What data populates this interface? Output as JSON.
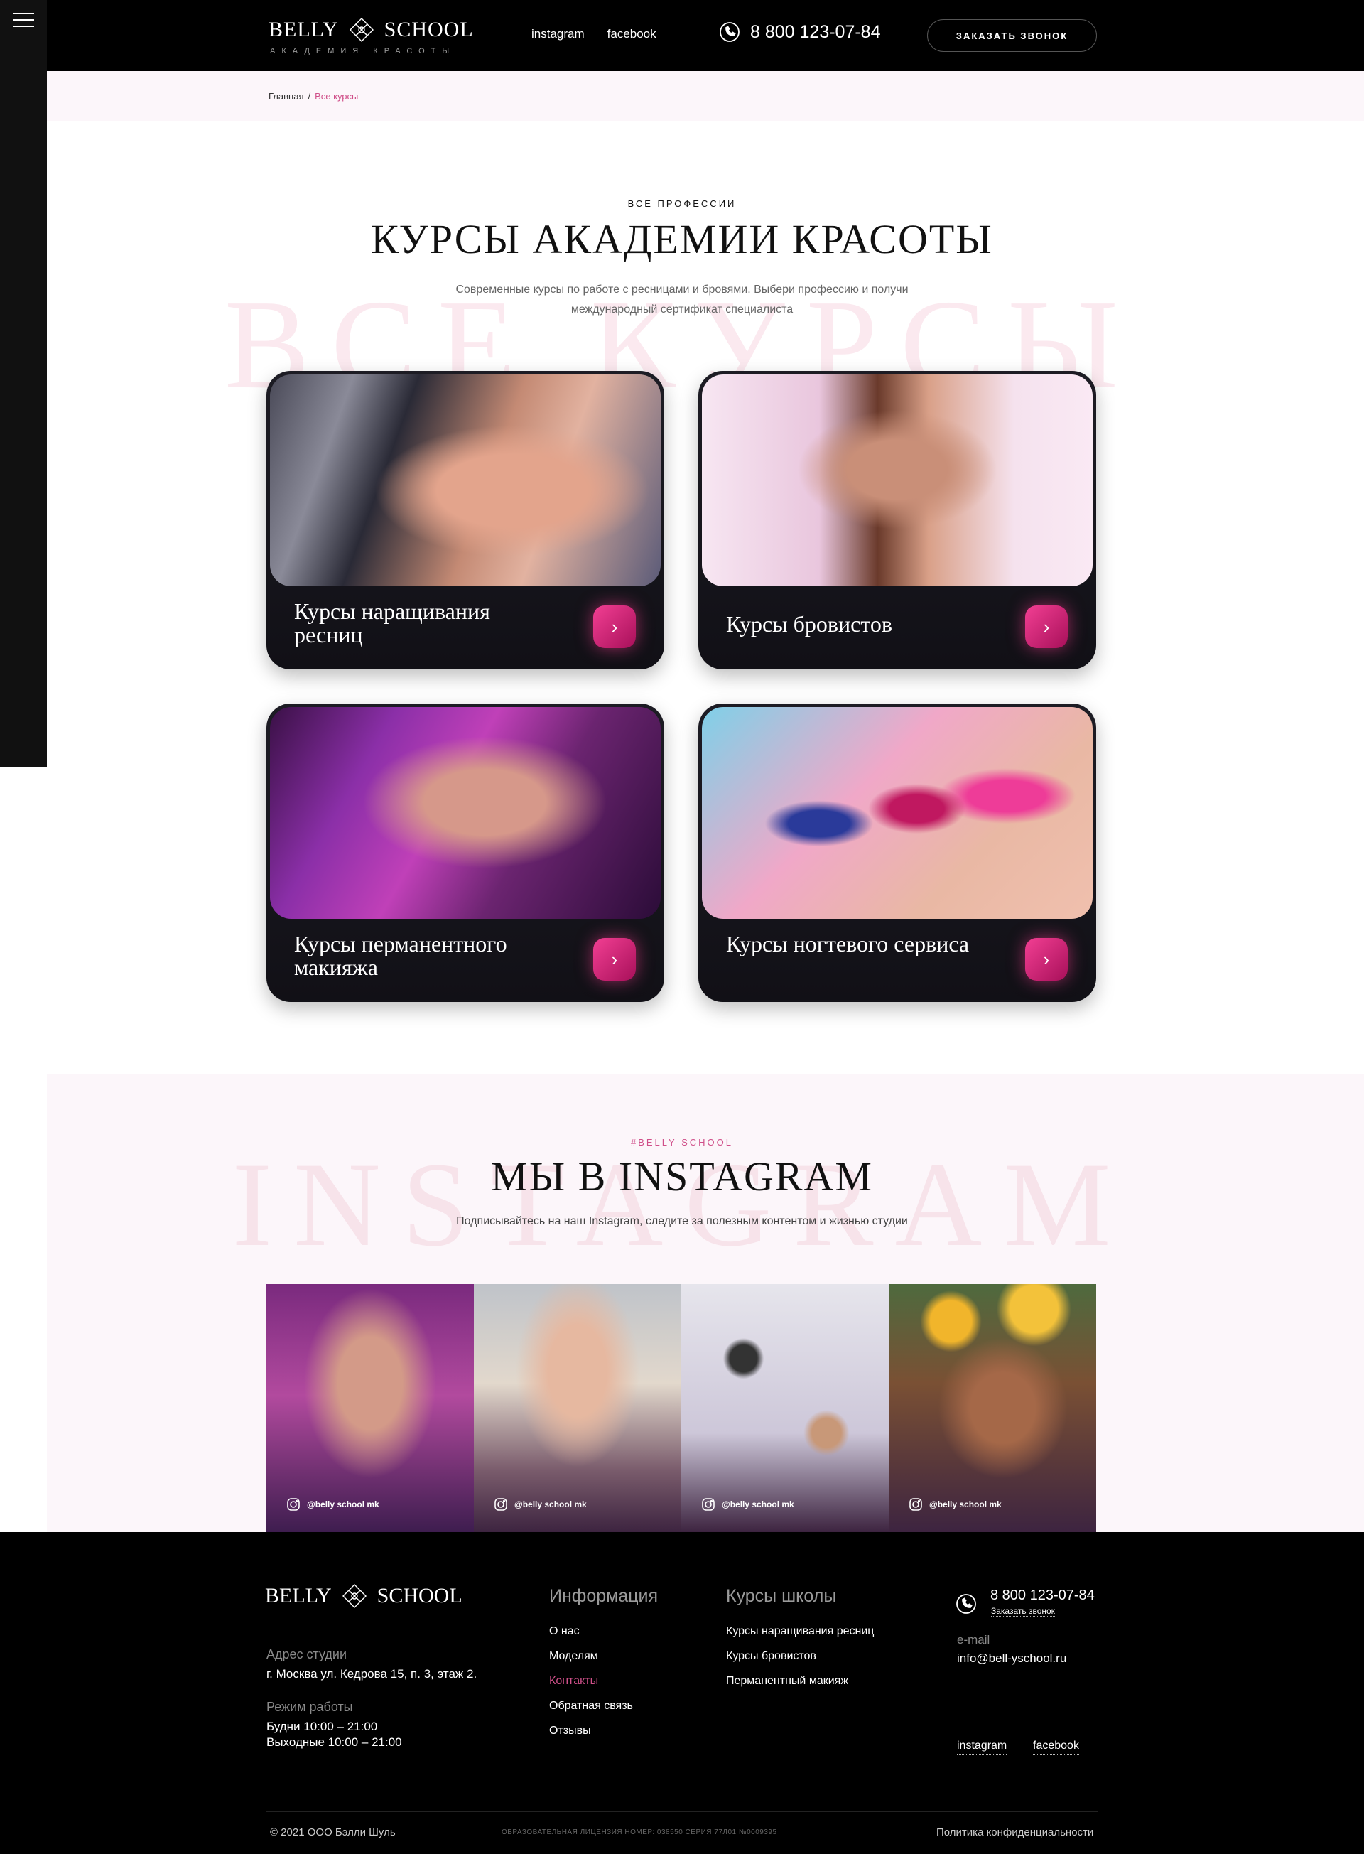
{
  "brand": {
    "word1": "BELLY",
    "word2": "SCHOOL",
    "tagline": "АКАДЕМИЯ КРАСОТЫ"
  },
  "header": {
    "links": [
      "instagram",
      "facebook"
    ],
    "phone": "8 800 123-07-84",
    "cta": "ЗАКАЗАТЬ ЗВОНОК"
  },
  "breadcrumb": {
    "home": "Главная",
    "separator": "/",
    "current": "Все курсы"
  },
  "courses_section": {
    "bg_word": "ВСЕ КУРСЫ",
    "eyebrow": "ВСЕ ПРОФЕССИИ",
    "title": "КУРСЫ АКАДЕМИИ КРАСОТЫ",
    "lead": "Современные курсы по работе с ресницами и бровями. Выбери профессию и получи международный сертификат специалиста",
    "cards": [
      {
        "title": "Курсы наращивания ресниц"
      },
      {
        "title": "Курсы бровистов"
      },
      {
        "title": "Курсы перманентного макияжа"
      },
      {
        "title": "Курсы ногтевого сервиса"
      }
    ],
    "arrow": "›"
  },
  "instagram_section": {
    "bg_word": "INSTAGRAM",
    "eyebrow": "#BELLY SCHOOL",
    "title": "МЫ В INSTAGRAM",
    "lead": "Подписывайтесь на наш Instagram, следите за полезным контентом и жизнью студии",
    "posts": [
      {
        "handle": "@belly school mk"
      },
      {
        "handle": "@belly school mk"
      },
      {
        "handle": "@belly school mk"
      },
      {
        "handle": "@belly school mk"
      }
    ]
  },
  "footer": {
    "address_label": "Адрес студии",
    "address": "г. Москва ул. Кедрова 15, п. 3, этаж 2.",
    "hours_label": "Режим работы",
    "weekdays": "Будни  10:00 – 21:00",
    "weekends": "Выходные  10:00 – 21:00",
    "info_title": "Информация",
    "info_links": [
      "О нас",
      "Моделям",
      "Контакты",
      "Обратная связь",
      "Отзывы"
    ],
    "courses_title": "Курсы школы",
    "courses_links": [
      "Курсы наращивания ресниц",
      "Курсы бровистов",
      "Перманентный макияж"
    ],
    "phone": "8 800 123-07-84",
    "callback": "Заказать звонок",
    "email_label": "e-mail",
    "email": "info@bell-yschool.ru",
    "social": [
      "instagram",
      "facebook"
    ],
    "copyright": "© 2021 ООО Бэлли Шуль",
    "license": "ОБРАЗОВАТЕЛЬНАЯ ЛИЦЕНЗИЯ НОМЕР: 038550 СЕРИЯ 77Л01 №0009395",
    "privacy": "Политика конфиденциальности"
  },
  "colors": {
    "accent": "#d0508a",
    "dark": "#000000",
    "soft_pink": "#fcf6fa"
  }
}
